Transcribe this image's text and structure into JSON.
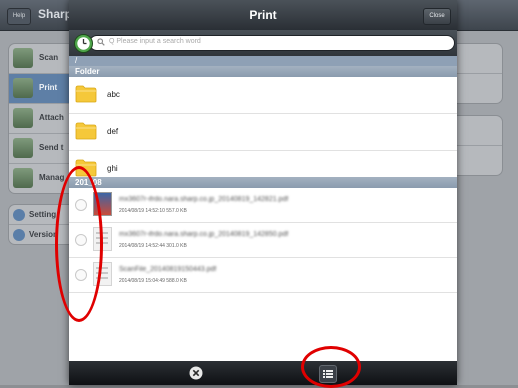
{
  "background": {
    "help_label": "Help",
    "title": "Sharp",
    "menu": [
      "Scan",
      "Print",
      "Attach",
      "Send t",
      "Manag"
    ],
    "menu_selected_index": 1,
    "bottom_menu": [
      "Setting",
      "Version"
    ]
  },
  "modal": {
    "title": "Print",
    "close_label": "Close",
    "search_placeholder": "Q  Please input a search word",
    "path": "/",
    "folder_section": "Folder",
    "folders": [
      "abc",
      "def",
      "ghi"
    ],
    "file_section": "201_08",
    "files": [
      {
        "name": "mx3607r-ifrdo.nara.sharp.co.jp_20140819_142821.pdf",
        "meta": "2014/08/19 14:52:10    557.0 KB"
      },
      {
        "name": "mx3607r-ifrdo.nara.sharp.co.jp_20140819_142850.pdf",
        "meta": "2014/08/19 14:52:44    301.0 KB"
      },
      {
        "name": "ScanFile_20140819150443.pdf",
        "meta": "2014/08/19 15:04:49    588.0 KB"
      }
    ]
  },
  "colors": {
    "accent_blue": "#5e7fa6",
    "header_dark": "#2a2f35",
    "annotation_red": "#e00000"
  },
  "icons": [
    "clock-icon",
    "search-icon",
    "folder-icon",
    "cancel-icon",
    "list-icon"
  ]
}
